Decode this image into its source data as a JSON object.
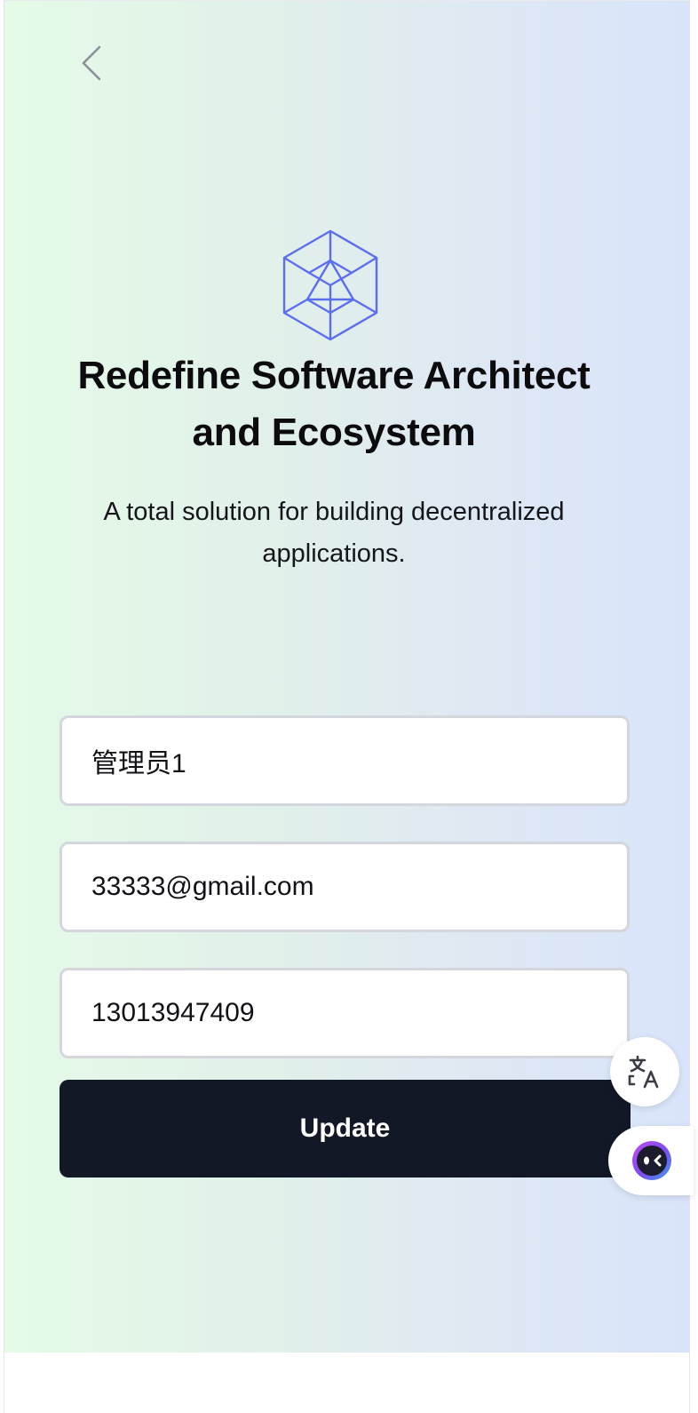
{
  "header": {
    "back_icon": "chevron-left-icon"
  },
  "hero": {
    "logo_icon": "hexagon-cube-icon",
    "title_line1": "Redefine Software Architect",
    "title_line2": "and Ecosystem",
    "subtitle_line1": "A total solution for building decentralized",
    "subtitle_line2": "applications."
  },
  "form": {
    "name_value": "管理员1",
    "email_value": "33333@gmail.com",
    "phone_value": "13013947409",
    "submit_label": "Update"
  },
  "floating": {
    "translate_icon": "translate-icon",
    "assistant_icon": "assistant-face-icon"
  },
  "colors": {
    "accent": "#5b6ef0",
    "button_bg": "#131827",
    "assistant_ring": "#7b4cf0"
  }
}
